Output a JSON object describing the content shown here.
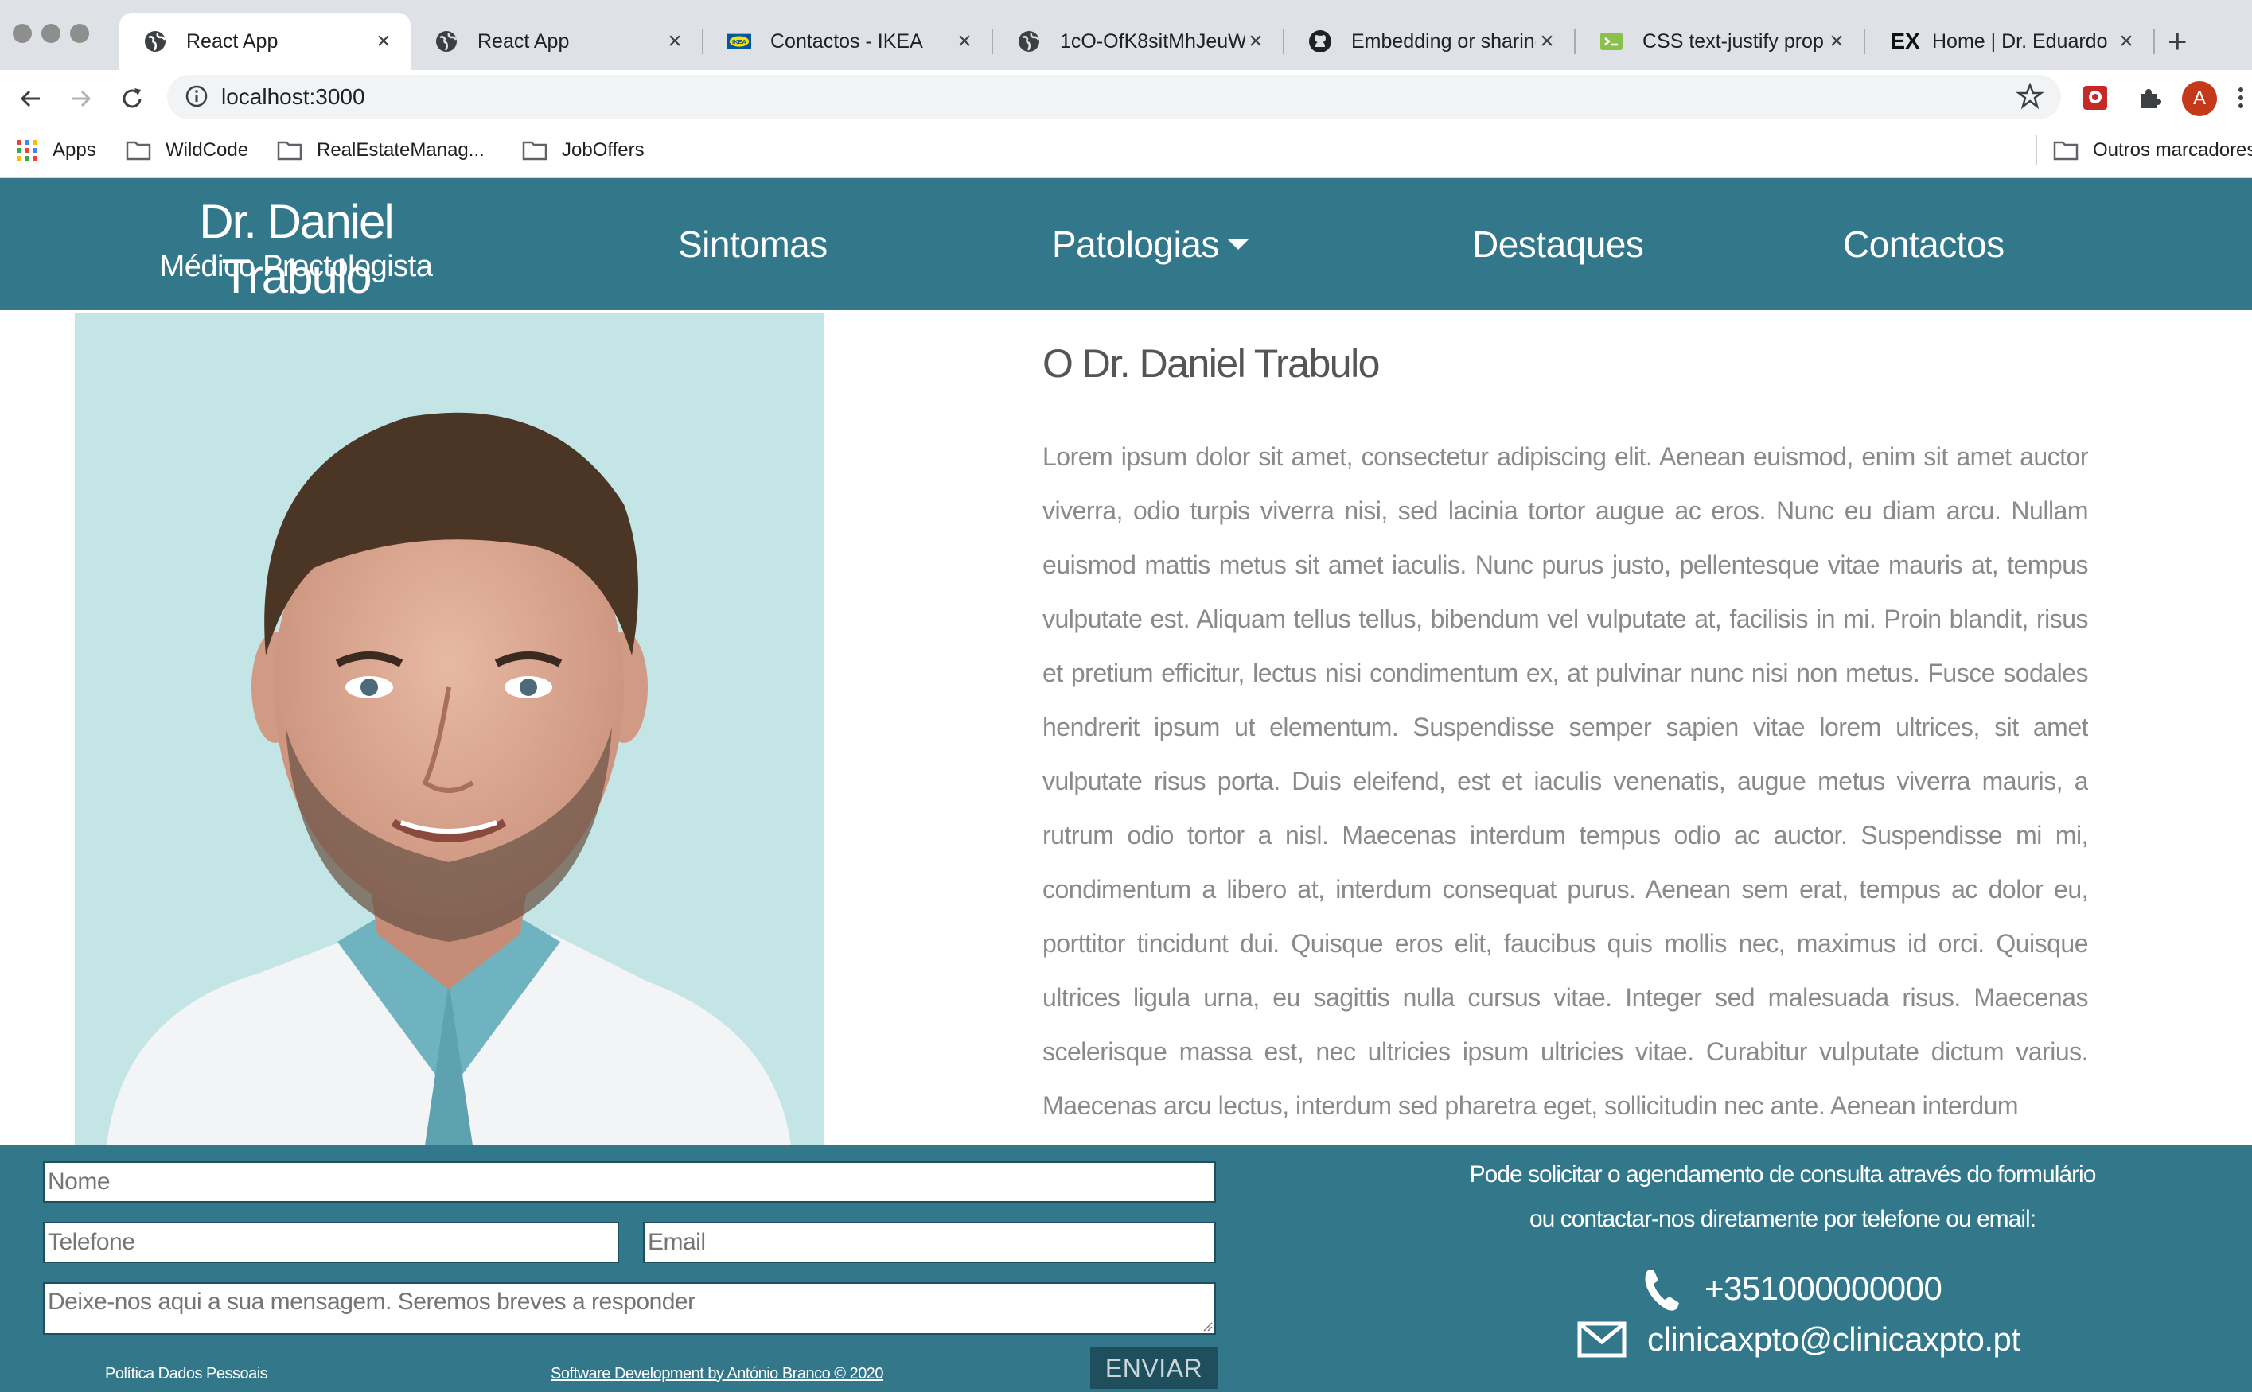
{
  "browser": {
    "tabs": [
      {
        "title": "React App",
        "icon": "globe-icon"
      },
      {
        "title": "React App",
        "icon": "globe-icon"
      },
      {
        "title": "Contactos - IKEA",
        "icon": "ikea-icon"
      },
      {
        "title": "1cO-OfK8sitMhJeuW",
        "icon": "globe-icon"
      },
      {
        "title": "Embedding or sharing",
        "icon": "github-icon"
      },
      {
        "title": "CSS text-justify prop",
        "icon": "css-icon"
      },
      {
        "title": "Home | Dr. Eduardo",
        "icon": "ex-icon",
        "icon_text": "EX"
      }
    ],
    "url": "localhost:3000",
    "avatar_letter": "A",
    "bookmarks": [
      {
        "label": "Apps",
        "icon": "apps-grid-icon"
      },
      {
        "label": "WildCode",
        "icon": "folder-icon"
      },
      {
        "label": "RealEstateManag...",
        "icon": "folder-icon"
      },
      {
        "label": "JobOffers",
        "icon": "folder-icon"
      },
      {
        "label": "Outros marcadores",
        "icon": "folder-icon"
      }
    ]
  },
  "header": {
    "brand_name": "Dr. Daniel Trabulo",
    "brand_subtitle": "Médico Proctologista",
    "nav": [
      "Sintomas",
      "Patologias",
      "Destaques",
      "Contactos"
    ]
  },
  "about": {
    "title": "O Dr. Daniel Trabulo",
    "body": "Lorem ipsum dolor sit amet, consectetur adipiscing elit. Aenean euismod, enim sit amet auctor viverra, odio turpis viverra nisi, sed lacinia tortor augue ac eros. Nunc eu diam arcu. Nullam euismod mattis metus sit amet iaculis. Nunc purus justo, pellentesque vitae mauris at, tempus vulputate est. Aliquam tellus tellus, bibendum vel vulputate at, facilisis in mi. Proin blandit, risus et pretium efficitur, lectus nisi condimentum ex, at pulvinar nunc nisi non metus. Fusce sodales hendrerit ipsum ut elementum. Suspendisse semper sapien vitae lorem ultrices, sit amet vulputate risus porta. Duis eleifend, est et iaculis venenatis, augue metus viverra mauris, a rutrum odio tortor a nisl. Maecenas interdum tempus odio ac auctor. Suspendisse mi mi, condimentum a libero at, interdum consequat purus. Aenean sem erat, tempus ac dolor eu, porttitor tincidunt dui. Quisque eros elit, faucibus quis mollis nec, maximus id orci. Quisque ultrices ligula urna, eu sagittis nulla cursus vitae. Integer sed malesuada risus. Maecenas scelerisque massa est, nec ultricies ipsum ultricies vitae. Curabitur vulputate dictum varius. Maecenas arcu lectus, interdum sed pharetra eget, sollicitudin nec ante. Aenean interdum"
  },
  "form": {
    "name_placeholder": "Nome",
    "phone_placeholder": "Telefone",
    "email_placeholder": "Email",
    "message_placeholder": "Deixe-nos aqui a sua mensagem. Seremos breves a responder",
    "submit_label": "ENVIAR"
  },
  "footer": {
    "policy_link": "Política Dados Pessoais",
    "credit_link": "Software Development by António Branco © 2020",
    "info_line_1": "Pode solicitar o agendamento de consulta através do formulário",
    "info_line_2": "ou contactar-nos diretamente por telefone ou email:",
    "phone": "+351000000000",
    "email": "clinicaxpto@clinicaxpto.pt"
  },
  "colors": {
    "brand_teal": "#33788a",
    "button_dark": "#1f4f5d",
    "body_text": "#8a8a8a"
  }
}
